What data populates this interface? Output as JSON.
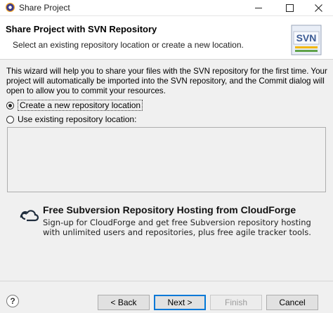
{
  "window": {
    "title": "Share Project"
  },
  "header": {
    "title": "Share Project with SVN Repository",
    "description": "Select an existing repository location or create a new location.",
    "logo_text": "SVN"
  },
  "intro": "This wizard will help you to share your files with the SVN repository for the first time. Your project will automatically be imported into the SVN repository, and the Commit dialog will open to allow you to commit your resources.",
  "options": {
    "create_new": {
      "label": "Create a new repository location",
      "selected": true
    },
    "use_existing": {
      "label": "Use existing repository location:",
      "selected": false
    }
  },
  "promo": {
    "title": "Free Subversion Repository Hosting from CloudForge",
    "body": "Sign-up for CloudForge and get free Subversion repository hosting with unlimited users and repositories, plus free agile tracker tools."
  },
  "buttons": {
    "help": "?",
    "back": "< Back",
    "next": "Next >",
    "finish": "Finish",
    "cancel": "Cancel"
  },
  "colors": {
    "accent": "#0078d7",
    "content_bg": "#f0f0f0"
  }
}
